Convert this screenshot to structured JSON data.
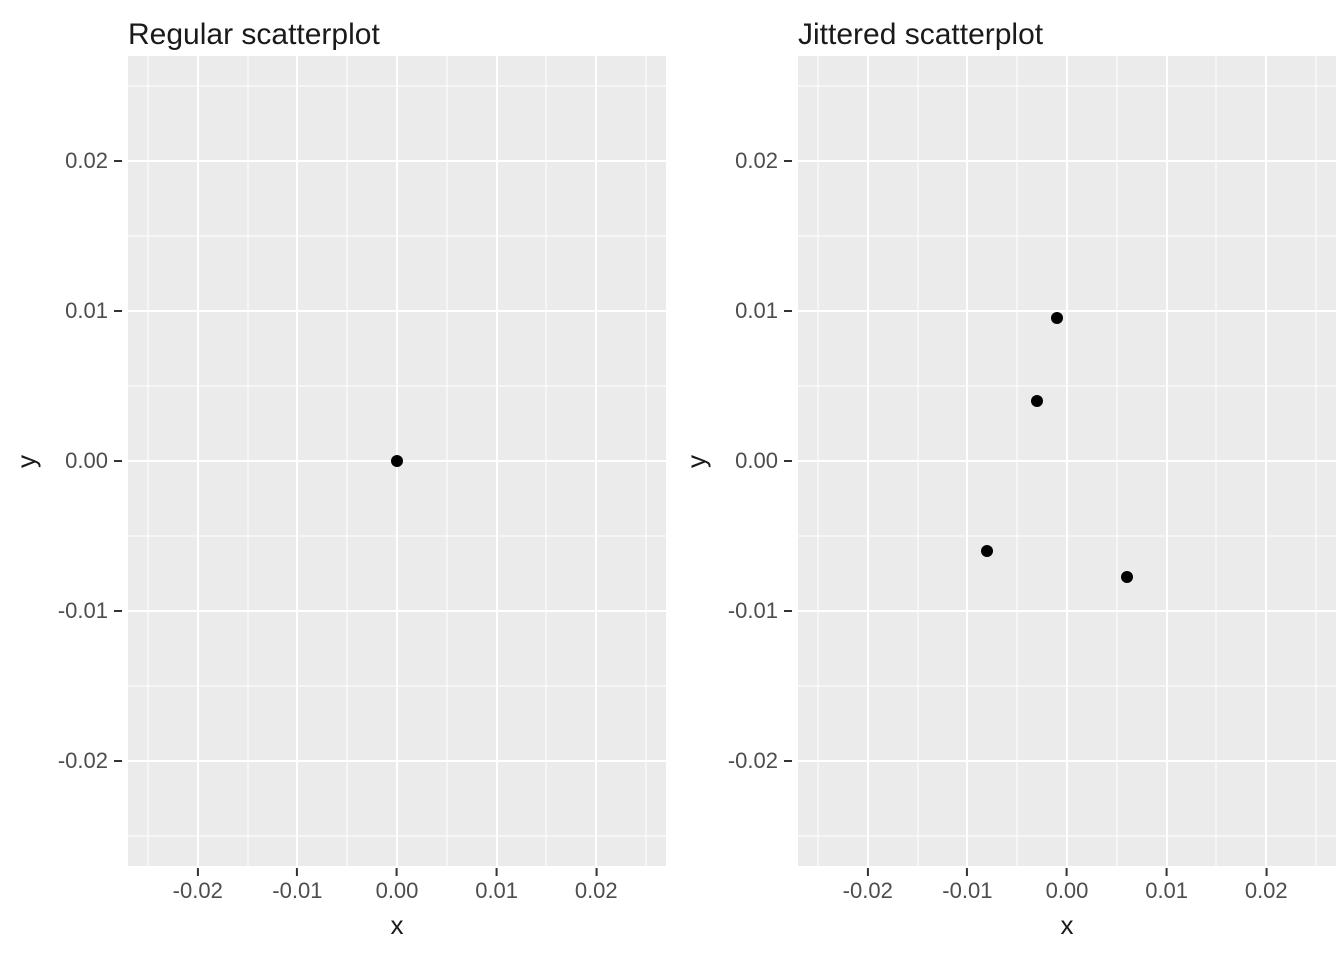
{
  "chart_data": [
    {
      "type": "scatter",
      "title": "Regular scatterplot",
      "xlabel": "x",
      "ylabel": "y",
      "xlim": [
        -0.027,
        0.027
      ],
      "ylim": [
        -0.027,
        0.027
      ],
      "x_major_ticks": [
        -0.02,
        -0.01,
        0.0,
        0.01,
        0.02
      ],
      "y_major_ticks": [
        -0.02,
        -0.01,
        0.0,
        0.01,
        0.02
      ],
      "x_tick_labels": [
        "-0.02",
        "-0.01",
        "0.00",
        "0.01",
        "0.02"
      ],
      "y_tick_labels": [
        "-0.02",
        "-0.01",
        "0.00",
        "0.01",
        "0.02"
      ],
      "x_minor_ticks": [
        -0.025,
        -0.015,
        -0.005,
        0.005,
        0.015,
        0.025
      ],
      "y_minor_ticks": [
        -0.025,
        -0.015,
        -0.005,
        0.005,
        0.015,
        0.025
      ],
      "series": [
        {
          "name": "points",
          "points": [
            {
              "x": 0.0,
              "y": 0.0
            }
          ]
        }
      ]
    },
    {
      "type": "scatter",
      "title": "Jittered scatterplot",
      "xlabel": "x",
      "ylabel": "y",
      "xlim": [
        -0.027,
        0.027
      ],
      "ylim": [
        -0.027,
        0.027
      ],
      "x_major_ticks": [
        -0.02,
        -0.01,
        0.0,
        0.01,
        0.02
      ],
      "y_major_ticks": [
        -0.02,
        -0.01,
        0.0,
        0.01,
        0.02
      ],
      "x_tick_labels": [
        "-0.02",
        "-0.01",
        "0.00",
        "0.01",
        "0.02"
      ],
      "y_tick_labels": [
        "-0.02",
        "-0.01",
        "0.00",
        "0.01",
        "0.02"
      ],
      "x_minor_ticks": [
        -0.025,
        -0.015,
        -0.005,
        0.005,
        0.015,
        0.025
      ],
      "y_minor_ticks": [
        -0.025,
        -0.015,
        -0.005,
        0.005,
        0.015,
        0.025
      ],
      "series": [
        {
          "name": "points",
          "points": [
            {
              "x": -0.001,
              "y": 0.0095
            },
            {
              "x": -0.003,
              "y": 0.004
            },
            {
              "x": -0.008,
              "y": -0.006
            },
            {
              "x": 0.006,
              "y": -0.0077
            }
          ]
        }
      ]
    }
  ]
}
